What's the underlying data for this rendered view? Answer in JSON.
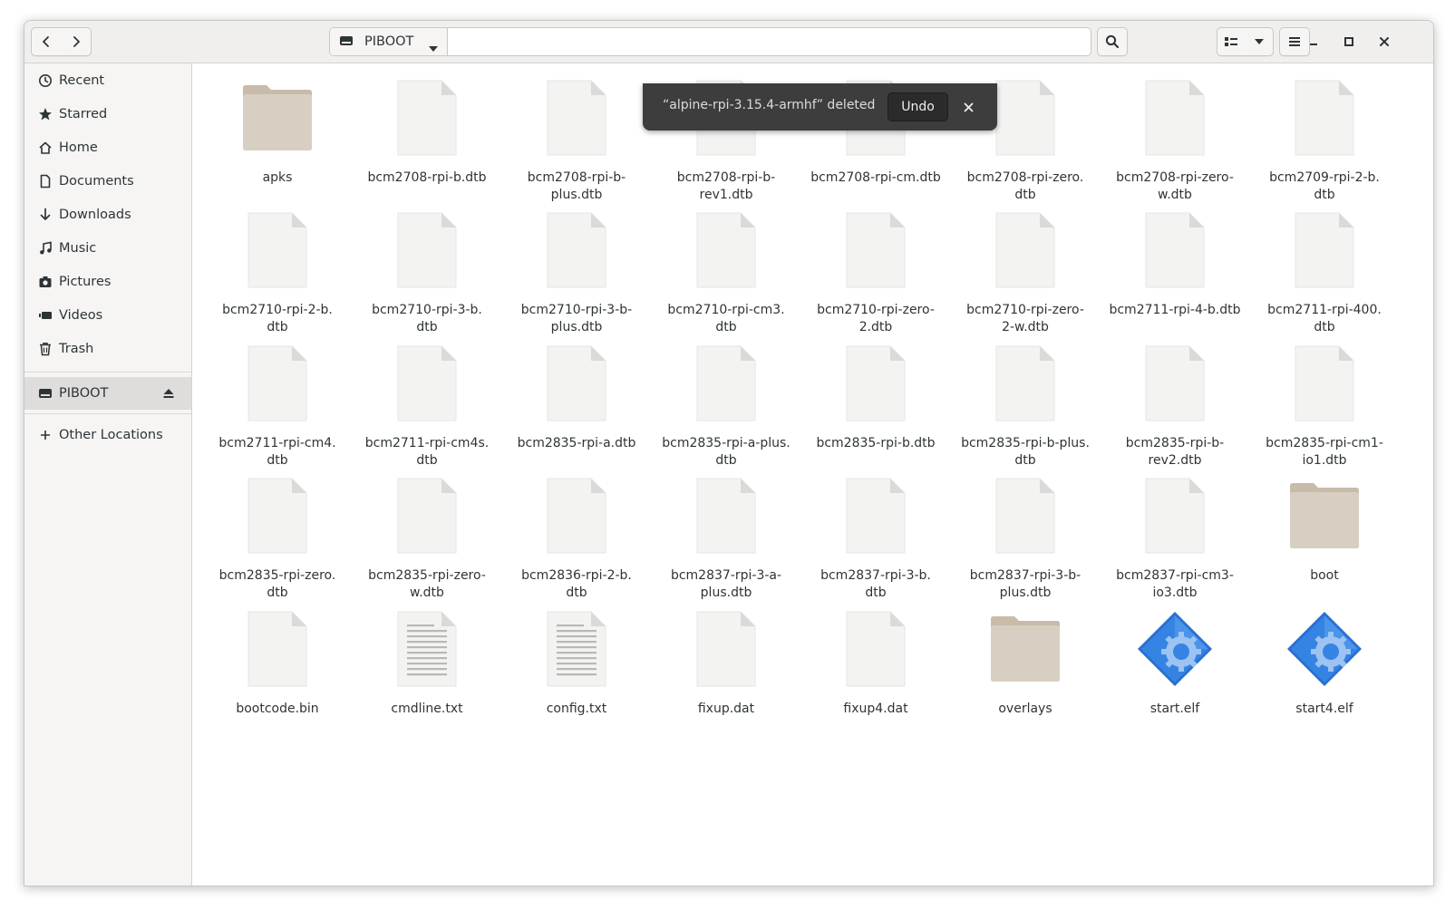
{
  "header": {
    "location_label": "PIBOOT",
    "icons": {
      "back": "chevron-left-icon",
      "forward": "chevron-right-icon",
      "drive": "drive-icon",
      "location_menu": "chevron-down-icon",
      "search": "search-icon",
      "view": "list-view-icon",
      "view_menu": "chevron-down-icon",
      "menu": "hamburger-menu-icon",
      "minimize": "minimize-icon",
      "maximize": "maximize-icon",
      "close": "close-icon"
    }
  },
  "sidebar": {
    "items": [
      {
        "label": "Recent",
        "icon": "clock-icon"
      },
      {
        "label": "Starred",
        "icon": "star-icon"
      },
      {
        "label": "Home",
        "icon": "home-icon"
      },
      {
        "label": "Documents",
        "icon": "document-icon"
      },
      {
        "label": "Downloads",
        "icon": "download-icon"
      },
      {
        "label": "Music",
        "icon": "music-icon"
      },
      {
        "label": "Pictures",
        "icon": "camera-icon"
      },
      {
        "label": "Videos",
        "icon": "video-icon"
      },
      {
        "label": "Trash",
        "icon": "trash-icon"
      }
    ],
    "mounted": {
      "label": "PIBOOT",
      "icon": "drive-icon",
      "eject_icon": "eject-icon"
    },
    "other_locations": {
      "label": "Other Locations",
      "icon": "plus-icon"
    }
  },
  "toast": {
    "message": "“alpine-rpi-3.15.4-armhf” deleted",
    "undo_label": "Undo",
    "close_icon": "close-icon"
  },
  "files": [
    {
      "name": "apks",
      "type": "folder"
    },
    {
      "name": "bcm2708-rpi-b.dtb",
      "type": "file"
    },
    {
      "name": "bcm2708-rpi-b-\nplus.dtb",
      "type": "file"
    },
    {
      "name": "bcm2708-rpi-b-\nrev1.dtb",
      "type": "file"
    },
    {
      "name": "bcm2708-rpi-cm.dtb",
      "type": "file"
    },
    {
      "name": "bcm2708-rpi-zero.\ndtb",
      "type": "file"
    },
    {
      "name": "bcm2708-rpi-zero-\nw.dtb",
      "type": "file"
    },
    {
      "name": "bcm2709-rpi-2-b.\ndtb",
      "type": "file"
    },
    {
      "name": "bcm2710-rpi-2-b.\ndtb",
      "type": "file"
    },
    {
      "name": "bcm2710-rpi-3-b.\ndtb",
      "type": "file"
    },
    {
      "name": "bcm2710-rpi-3-b-\nplus.dtb",
      "type": "file"
    },
    {
      "name": "bcm2710-rpi-cm3.\ndtb",
      "type": "file"
    },
    {
      "name": "bcm2710-rpi-zero-\n2.dtb",
      "type": "file"
    },
    {
      "name": "bcm2710-rpi-zero-\n2-w.dtb",
      "type": "file"
    },
    {
      "name": "bcm2711-rpi-4-b.dtb",
      "type": "file"
    },
    {
      "name": "bcm2711-rpi-400.\ndtb",
      "type": "file"
    },
    {
      "name": "bcm2711-rpi-cm4.\ndtb",
      "type": "file"
    },
    {
      "name": "bcm2711-rpi-cm4s.\ndtb",
      "type": "file"
    },
    {
      "name": "bcm2835-rpi-a.dtb",
      "type": "file"
    },
    {
      "name": "bcm2835-rpi-a-plus.\ndtb",
      "type": "file"
    },
    {
      "name": "bcm2835-rpi-b.dtb",
      "type": "file"
    },
    {
      "name": "bcm2835-rpi-b-plus.\ndtb",
      "type": "file"
    },
    {
      "name": "bcm2835-rpi-b-\nrev2.dtb",
      "type": "file"
    },
    {
      "name": "bcm2835-rpi-cm1-\nio1.dtb",
      "type": "file"
    },
    {
      "name": "bcm2835-rpi-zero.\ndtb",
      "type": "file"
    },
    {
      "name": "bcm2835-rpi-zero-\nw.dtb",
      "type": "file"
    },
    {
      "name": "bcm2836-rpi-2-b.\ndtb",
      "type": "file"
    },
    {
      "name": "bcm2837-rpi-3-a-\nplus.dtb",
      "type": "file"
    },
    {
      "name": "bcm2837-rpi-3-b.\ndtb",
      "type": "file"
    },
    {
      "name": "bcm2837-rpi-3-b-\nplus.dtb",
      "type": "file"
    },
    {
      "name": "bcm2837-rpi-cm3-\nio3.dtb",
      "type": "file"
    },
    {
      "name": "boot",
      "type": "folder"
    },
    {
      "name": "bootcode.bin",
      "type": "file"
    },
    {
      "name": "cmdline.txt",
      "type": "text"
    },
    {
      "name": "config.txt",
      "type": "text"
    },
    {
      "name": "fixup.dat",
      "type": "file"
    },
    {
      "name": "fixup4.dat",
      "type": "file"
    },
    {
      "name": "overlays",
      "type": "folder"
    },
    {
      "name": "start.elf",
      "type": "executable"
    },
    {
      "name": "start4.elf",
      "type": "executable"
    }
  ],
  "colors": {
    "folder": "#d8cfc3",
    "folder_tab": "#c8bba9",
    "file": "#f3f3f2",
    "file_fold": "#dadad8",
    "exec_blue": "#3584e4",
    "toast_bg": "#3d3d3d"
  }
}
